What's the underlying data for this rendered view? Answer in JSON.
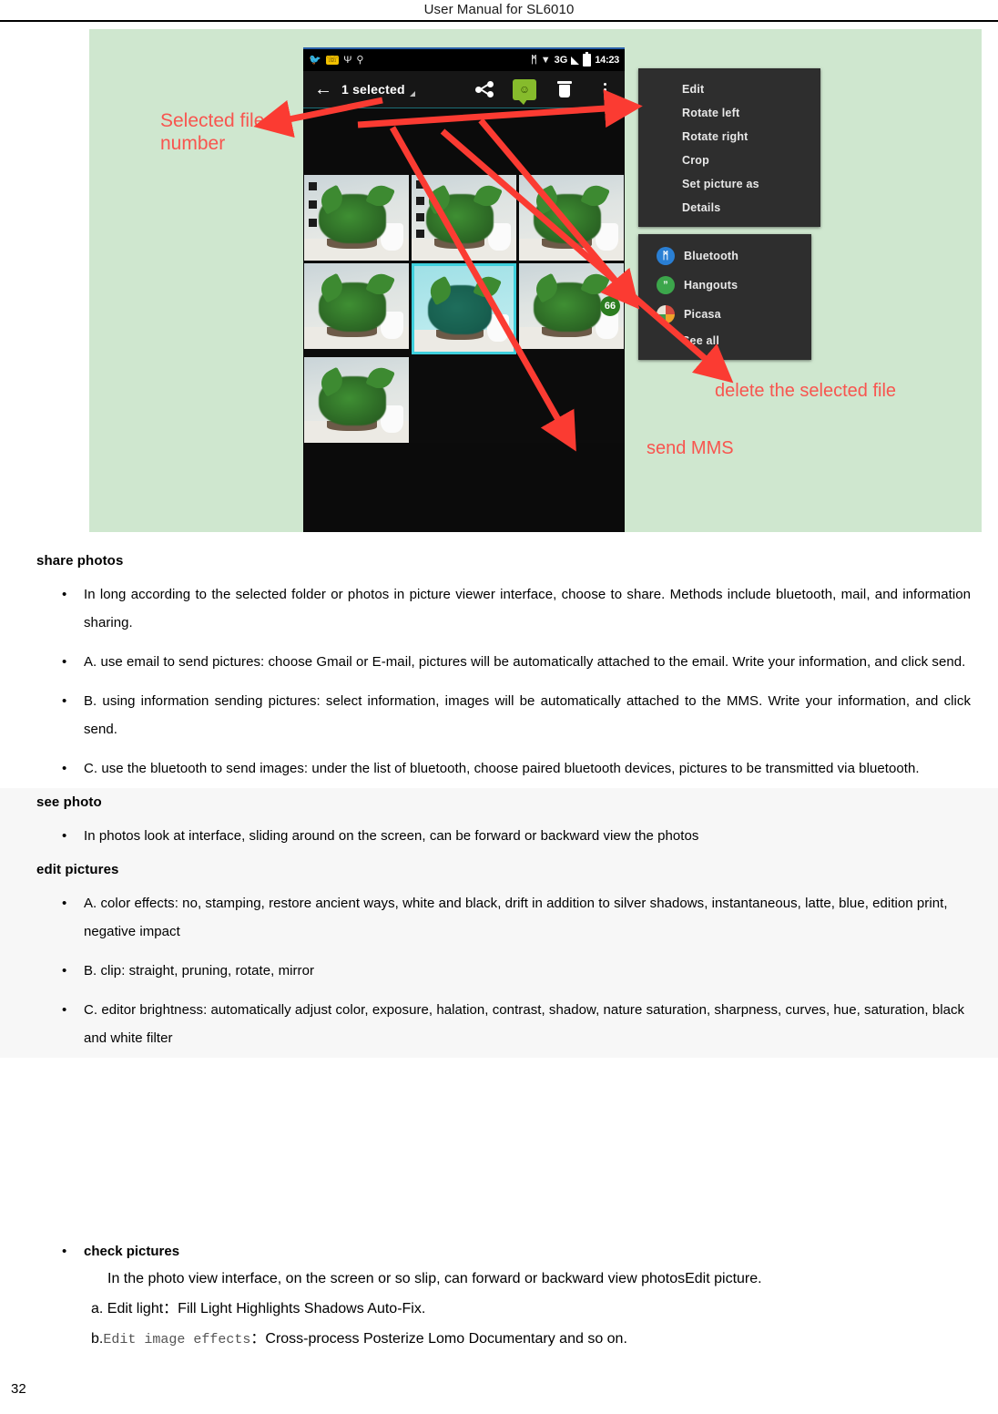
{
  "header": {
    "title": "User Manual for SL6010"
  },
  "figure": {
    "phone": {
      "status_bar": {
        "icons": [
          "bird-icon",
          "sim-card-icon",
          "usb-icon",
          "usb-debug-icon"
        ],
        "right_icons": [
          "bluetooth-icon",
          "wifi-icon",
          "signal-icon",
          "battery-icon"
        ],
        "network": "3G",
        "clock": "14:23"
      },
      "action_bar": {
        "back": "←",
        "selected_label": "1 selected",
        "buttons": [
          "share-icon",
          "mms-icon",
          "delete-icon",
          "overflow-menu-icon"
        ]
      },
      "grid": {
        "badge": "66",
        "thumbnails": [
          {
            "selected_marks": 3,
            "highlighted": false
          },
          {
            "selected_marks": 4,
            "highlighted": false
          },
          {
            "selected_marks": 0,
            "highlighted": false
          },
          {
            "selected_marks": 0,
            "highlighted": false
          },
          {
            "selected_marks": 0,
            "highlighted": true
          },
          {
            "selected_marks": 0,
            "highlighted": false
          },
          {
            "selected_marks": 0,
            "highlighted": false
          }
        ]
      }
    },
    "menu_edit": {
      "items": [
        "Edit",
        "Rotate left",
        "Rotate right",
        "Crop",
        "Set picture as",
        "Details"
      ]
    },
    "menu_share": {
      "items": [
        {
          "label": "Bluetooth",
          "icon": "bluetooth-app-icon",
          "glyph": "ᛗ"
        },
        {
          "label": "Hangouts",
          "icon": "hangouts-app-icon",
          "glyph": "”"
        },
        {
          "label": "Picasa",
          "icon": "picasa-app-icon",
          "glyph": ""
        },
        {
          "label": "See all",
          "icon": "",
          "glyph": ""
        }
      ]
    },
    "annotations": {
      "selected_file_number": "Selected file\nnumber",
      "delete_selected_file": "delete the selected file",
      "send_mms": "send MMS"
    },
    "colors": {
      "panel_background": "#cfe7cf",
      "annotation_red": "#f8554f",
      "arrow_red": "#fb3b32",
      "selection_cyan": "#3fd0dd"
    }
  },
  "content": {
    "sections": [
      {
        "heading": "share photos",
        "bullets": [
          "In long according to the selected folder or photos in picture viewer interface, choose to share. Methods include bluetooth, mail, and information sharing.",
          "A. use email to send pictures: choose Gmail or E-mail, pictures will be automatically attached to the email. Write your information, and click send.",
          "B. using information sending pictures: select information, images will be automatically attached to the MMS. Write your information, and click send.",
          "C. use the bluetooth to send images: under the list of bluetooth, choose paired bluetooth devices, pictures to be transmitted via bluetooth."
        ]
      },
      {
        "heading": "see photo",
        "bullets": [
          "In photos look at interface, sliding around on the screen, can be forward or backward view the photos"
        ]
      },
      {
        "heading": "edit pictures",
        "bullets": [
          "A. color effects: no, stamping, restore ancient ways, white and black, drift in addition to silver shadows, instantaneous, latte, blue, edition print, negative impact",
          "B. clip: straight, pruning, rotate, mirror",
          "C. editor brightness: automatically adjust color, exposure, halation, contrast, shadow, nature saturation, sharpness, curves, hue, saturation, black and white filter"
        ]
      }
    ],
    "tail": {
      "check_pictures_label": "check pictures",
      "view_line": "In the photo view interface, on the screen or so slip, can forward or backward view photosEdit picture.",
      "item_a_prefix": "a. Edit light：",
      "item_a_value": "Fill Light    Highlights    Shadows    Auto-Fix.",
      "item_b_prefix": "b.",
      "item_b_mono": "Edit image effects",
      "item_b_sep": "：",
      "item_b_value": "Cross-process    Posterize    Lomo    Documentary and so on."
    }
  },
  "footer": {
    "page_number": "32"
  }
}
